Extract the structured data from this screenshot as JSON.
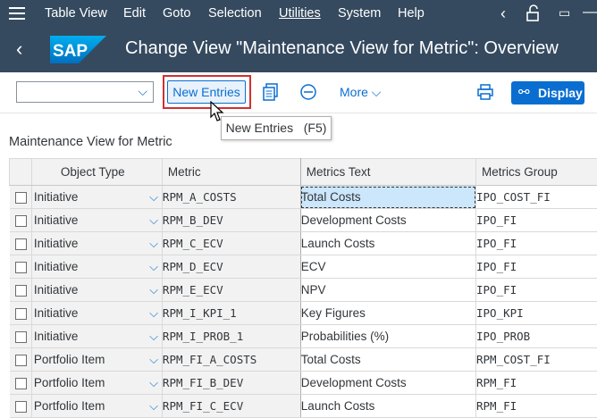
{
  "menubar": {
    "items": [
      "Table View",
      "Edit",
      "Goto",
      "Selection",
      "Utilities",
      "System",
      "Help"
    ]
  },
  "titlebar": {
    "logo_text": "SAP",
    "title": "Change View \"Maintenance View for Metric\": Overview"
  },
  "toolbar": {
    "new_entries_label": "New Entries",
    "more_label": "More",
    "display_label": "Display"
  },
  "tooltip": {
    "text": "New Entries   (F5)"
  },
  "section": {
    "title": "Maintenance View for Metric"
  },
  "table": {
    "headers": [
      "Object Type",
      "Metric",
      "Metrics Text",
      "Metrics Group"
    ],
    "rows": [
      [
        "Initiative",
        "RPM_A_COSTS",
        "Total Costs",
        "IPO_COST_FI"
      ],
      [
        "Initiative",
        "RPM_B_DEV",
        "Development Costs",
        "IPO_FI"
      ],
      [
        "Initiative",
        "RPM_C_ECV",
        "Launch Costs",
        "IPO_FI"
      ],
      [
        "Initiative",
        "RPM_D_ECV",
        "ECV",
        "IPO_FI"
      ],
      [
        "Initiative",
        "RPM_E_ECV",
        "NPV",
        "IPO_FI"
      ],
      [
        "Initiative",
        "RPM_I_KPI_1",
        "Key Figures",
        "IPO_KPI"
      ],
      [
        "Initiative",
        "RPM_I_PROB_1",
        "Probabilities (%)",
        "IPO_PROB"
      ],
      [
        "Portfolio Item",
        "RPM_FI_A_COSTS",
        "Total Costs",
        "RPM_COST_FI"
      ],
      [
        "Portfolio Item",
        "RPM_FI_B_DEV",
        "Development Costs",
        "RPM_FI"
      ],
      [
        "Portfolio Item",
        "RPM_FI_C_ECV",
        "Launch Costs",
        "RPM_FI"
      ]
    ]
  },
  "colors": {
    "shell": "#354a5f",
    "accent": "#0a6ed1",
    "highlight_border": "#d03030"
  }
}
